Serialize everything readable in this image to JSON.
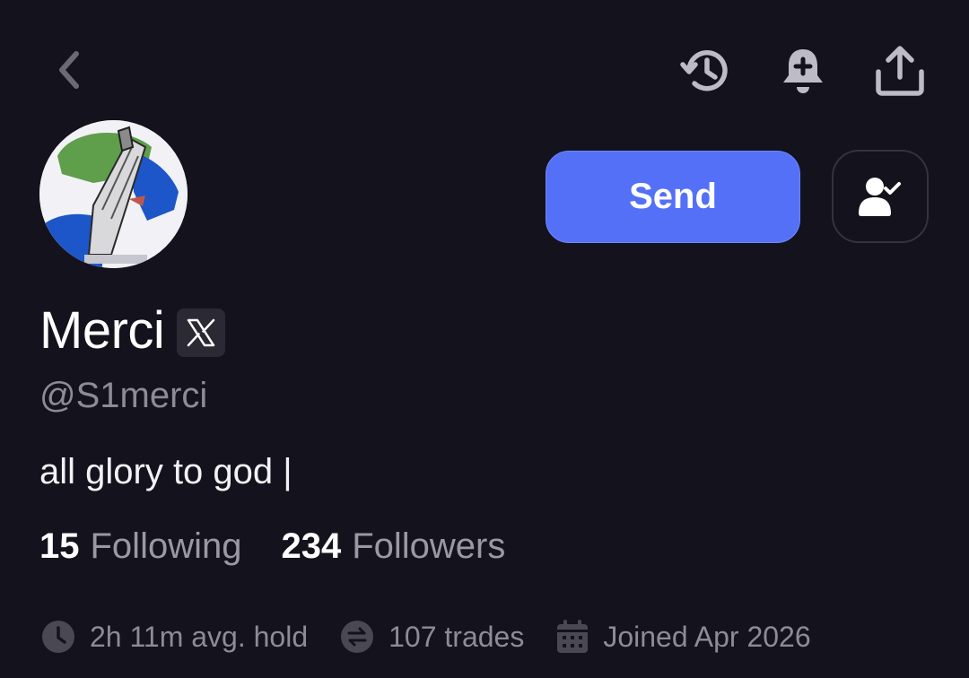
{
  "nav": {
    "back_icon": "chevron-left-icon",
    "actions": [
      {
        "name": "history-icon"
      },
      {
        "name": "bell-add-icon"
      },
      {
        "name": "share-icon"
      }
    ]
  },
  "profile": {
    "display_name": "Merci",
    "handle": "@S1merci",
    "bio": "all glory to god |",
    "social_badge": "x-logo-icon"
  },
  "actions": {
    "send_label": "Send",
    "follow_icon": "user-check-icon"
  },
  "stats": {
    "following_count": "15",
    "following_label": "Following",
    "followers_count": "234",
    "followers_label": "Followers"
  },
  "meta": {
    "avg_hold": "2h 11m avg. hold",
    "trades": "107 trades",
    "joined": "Joined Apr 2026"
  },
  "colors": {
    "background": "#13121d",
    "accent": "#5470f7",
    "muted_text": "#8d8b96"
  }
}
